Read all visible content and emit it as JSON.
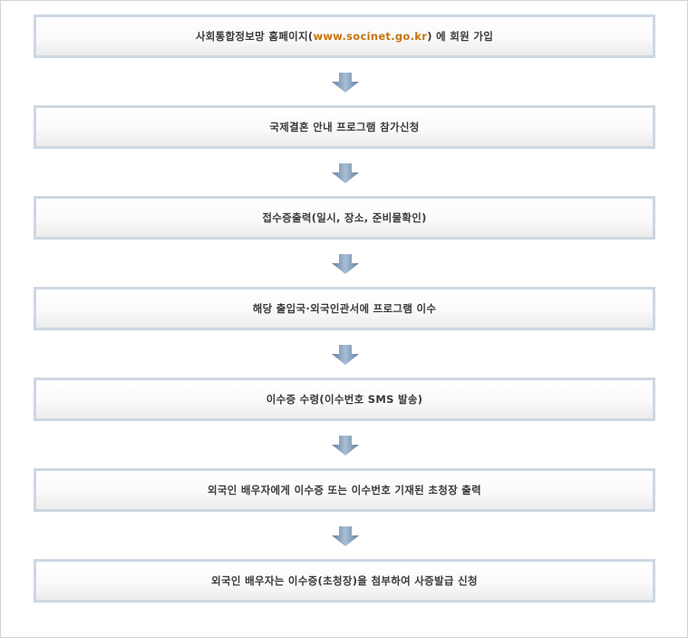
{
  "steps": [
    {
      "before": "사회통합정보망 홈페이지(",
      "link": "www.socinet.go.kr",
      "after": ") 에 회원 가입"
    },
    {
      "text": "국제결혼 안내 프로그램 참가신청"
    },
    {
      "text": "접수증출력(일시, 장소, 준비물확인)"
    },
    {
      "text": "해당 출입국·외국인관서에 프로그램 이수"
    },
    {
      "text": "이수증 수령(이수번호 SMS 발송)"
    },
    {
      "text": "외국인 배우자에게 이수증 또는 이수번호 기재된 초청장 출력"
    },
    {
      "text": "외국인 배우자는 이수증(초청장)을 첨부하여 사증발급 신청"
    }
  ],
  "colors": {
    "box_border": "#cdd7e2",
    "arrow_fill": "#7f9ab8",
    "link_text": "#c8730b",
    "body_text": "#3a3a3a"
  },
  "icons": {
    "connector": "down-arrow-icon"
  }
}
